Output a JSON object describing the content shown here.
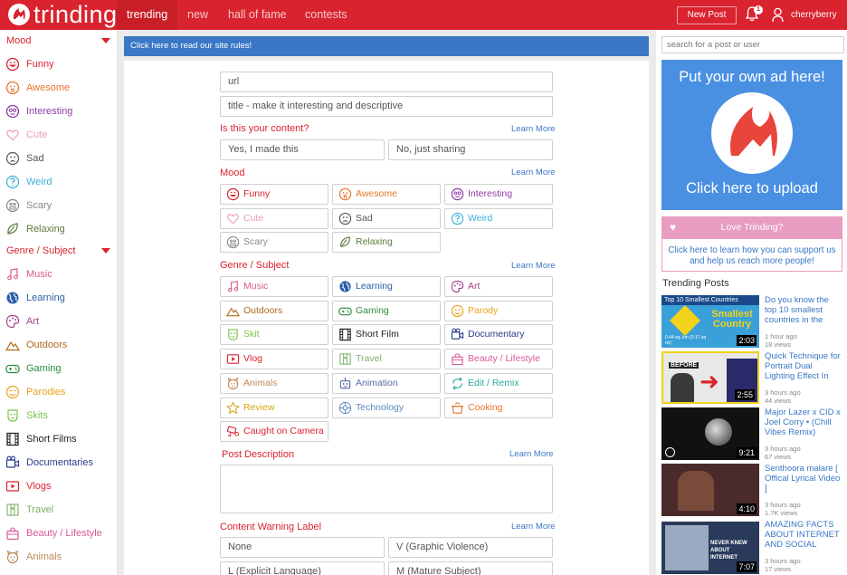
{
  "header": {
    "logo_text": "trinding",
    "tabs": [
      {
        "label": "trending",
        "active": true
      },
      {
        "label": "new"
      },
      {
        "label": "hall of fame"
      },
      {
        "label": "contests"
      }
    ],
    "new_post_label": "New Post",
    "notification_count": "1",
    "username": "cherryberry",
    "brand_color": "#d9232e"
  },
  "sidebar": {
    "mood_heading": "Mood",
    "mood_items": [
      {
        "label": "Funny",
        "color": "#d9232e",
        "icon": "funny-face-icon"
      },
      {
        "label": "Awesome",
        "color": "#e8742a",
        "icon": "awesome-face-icon"
      },
      {
        "label": "Interesting",
        "color": "#8e3ca2",
        "icon": "interesting-face-icon"
      },
      {
        "label": "Cute",
        "color": "#e89cc1",
        "icon": "heart-icon"
      },
      {
        "label": "Sad",
        "color": "#555555",
        "icon": "sad-face-icon"
      },
      {
        "label": "Weird",
        "color": "#3ab0d9",
        "icon": "question-icon"
      },
      {
        "label": "Scary",
        "color": "#888888",
        "icon": "scary-face-icon"
      },
      {
        "label": "Relaxing",
        "color": "#5a7a3a",
        "icon": "leaf-icon"
      }
    ],
    "genre_heading": "Genre / Subject",
    "genre_items": [
      {
        "label": "Music",
        "color": "#d95a8a",
        "icon": "music-note-icon"
      },
      {
        "label": "Learning",
        "color": "#2a5fa8",
        "icon": "globe-icon"
      },
      {
        "label": "Art",
        "color": "#a0468a",
        "icon": "palette-icon"
      },
      {
        "label": "Outdoors",
        "color": "#b06a1a",
        "icon": "mountain-icon"
      },
      {
        "label": "Gaming",
        "color": "#2a8a3a",
        "icon": "gamepad-icon"
      },
      {
        "label": "Parodies",
        "color": "#e8a21a",
        "icon": "mask-icon"
      },
      {
        "label": "Skits",
        "color": "#7ac04a",
        "icon": "skit-icon"
      },
      {
        "label": "Short Films",
        "color": "#222222",
        "icon": "film-icon"
      },
      {
        "label": "Documentaries",
        "color": "#2a3a8a",
        "icon": "camera-icon"
      },
      {
        "label": "Vlogs",
        "color": "#d9232e",
        "icon": "video-icon"
      },
      {
        "label": "Travel",
        "color": "#7ab06a",
        "icon": "map-icon"
      },
      {
        "label": "Beauty / Lifestyle",
        "color": "#d95a9a",
        "icon": "bag-icon"
      },
      {
        "label": "Animals",
        "color": "#c08a5a",
        "icon": "paw-icon"
      }
    ]
  },
  "rules_bar": "Click here to read our site rules!",
  "form": {
    "url_placeholder": "url",
    "title_placeholder": "title - make it interesting and descriptive",
    "ownership_label": "Is this your content?",
    "learn_more": "Learn More",
    "ownership_options": [
      "Yes, I made this",
      "No, just sharing"
    ],
    "mood_label": "Mood",
    "mood_options": [
      {
        "label": "Funny",
        "color": "#d9232e",
        "icon": "funny-face-icon"
      },
      {
        "label": "Awesome",
        "color": "#e8742a",
        "icon": "awesome-face-icon"
      },
      {
        "label": "Interesting",
        "color": "#8e3ca2",
        "icon": "interesting-face-icon"
      },
      {
        "label": "Cute",
        "color": "#e89cc1",
        "icon": "heart-icon"
      },
      {
        "label": "Sad",
        "color": "#555555",
        "icon": "sad-face-icon"
      },
      {
        "label": "Weird",
        "color": "#3ab0d9",
        "icon": "question-icon"
      },
      {
        "label": "Scary",
        "color": "#888888",
        "icon": "scary-face-icon"
      },
      {
        "label": "Relaxing",
        "color": "#5a7a3a",
        "icon": "leaf-icon"
      }
    ],
    "genre_label": "Genre / Subject",
    "genre_options": [
      {
        "label": "Music",
        "color": "#d95a8a",
        "icon": "music-note-icon"
      },
      {
        "label": "Learning",
        "color": "#2a5fa8",
        "icon": "globe-icon"
      },
      {
        "label": "Art",
        "color": "#a0468a",
        "icon": "palette-icon"
      },
      {
        "label": "Outdoors",
        "color": "#b06a1a",
        "icon": "mountain-icon"
      },
      {
        "label": "Gaming",
        "color": "#2a8a3a",
        "icon": "gamepad-icon"
      },
      {
        "label": "Parody",
        "color": "#e8a21a",
        "icon": "mask-icon"
      },
      {
        "label": "Skit",
        "color": "#7ac04a",
        "icon": "skit-icon"
      },
      {
        "label": "Short Film",
        "color": "#222222",
        "icon": "film-icon"
      },
      {
        "label": "Documentary",
        "color": "#2a3a8a",
        "icon": "camera-icon"
      },
      {
        "label": "Vlog",
        "color": "#d9232e",
        "icon": "video-icon"
      },
      {
        "label": "Travel",
        "color": "#7ab06a",
        "icon": "map-icon"
      },
      {
        "label": "Beauty / Lifestyle",
        "color": "#d95a9a",
        "icon": "bag-icon"
      },
      {
        "label": "Animals",
        "color": "#c08a5a",
        "icon": "paw-icon"
      },
      {
        "label": "Animation",
        "color": "#5a6aa8",
        "icon": "robot-icon"
      },
      {
        "label": "Edit / Remix",
        "color": "#2aa89a",
        "icon": "remix-icon"
      },
      {
        "label": "Review",
        "color": "#d9a21a",
        "icon": "star-icon"
      },
      {
        "label": "Technology",
        "color": "#5a8ac0",
        "icon": "tech-icon"
      },
      {
        "label": "Cooking",
        "color": "#e8742a",
        "icon": "pot-icon"
      },
      {
        "label": "Caught on Camera",
        "color": "#d9232e",
        "icon": "cctv-icon"
      }
    ],
    "description_label": "Post Description",
    "warning_label": "Content Warning Label",
    "warning_options": [
      "None",
      "V (Graphic Violence)",
      "L (Explicit Language)",
      "M (Mature Subject)"
    ]
  },
  "right": {
    "search_placeholder": "search for a post or user",
    "ad_top": "Put your own ad here!",
    "ad_bottom": "Click here to upload",
    "love_title": "Love Trinding?",
    "love_text": "Click here to learn how you can support us and help us reach more people!",
    "trending_title": "Trending Posts",
    "posts": [
      {
        "title": "Do you know the top 10 smallest countries in the",
        "time": "1 hour ago",
        "views": "18 views",
        "duration": "2:03",
        "thumb_caption": "Top 10 Smallest Countries",
        "thumb_text": "Smallest Country",
        "thumb_sub": "0.44 sq. km (0.17 sq mi)"
      },
      {
        "title": "Quick Technique for Portrait Dual Lighting Effect In",
        "time": "3 hours ago",
        "views": "44 views",
        "duration": "2:55",
        "thumb_text": "BEFORE"
      },
      {
        "title": "Major Lazer x CID x Joel Corry • (Chill Vibes Remix)",
        "time": "3 hours ago",
        "views": "67 views",
        "duration": "9:21"
      },
      {
        "title": "Senthoora malare [ Offical Lyrical Video ]",
        "time": "3 hours ago",
        "views": "1.7K views",
        "duration": "4:10"
      },
      {
        "title": "AMAZING FACTS ABOUT INTERNET AND SOCIAL",
        "time": "3 hours ago",
        "views": "17 views",
        "duration": "7:07",
        "thumb_text": "NEVER KNEW ABOUT INTERNET"
      }
    ]
  }
}
